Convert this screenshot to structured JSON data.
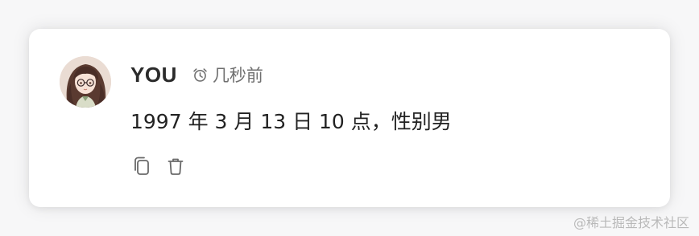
{
  "message": {
    "author": "YOU",
    "time": "几秒前",
    "text": "1997 年 3 月 13 日 10 点，性别男",
    "avatar_icon": "anime-girl-avatar",
    "time_icon": "alarm-clock-icon"
  },
  "actions": [
    {
      "name": "copy",
      "icon": "copy-icon"
    },
    {
      "name": "delete",
      "icon": "trash-icon"
    }
  ],
  "watermark": "@稀土掘金技术社区",
  "colors": {
    "card_background": "#ffffff",
    "text": "#222222",
    "muted": "#6f6f6f"
  }
}
